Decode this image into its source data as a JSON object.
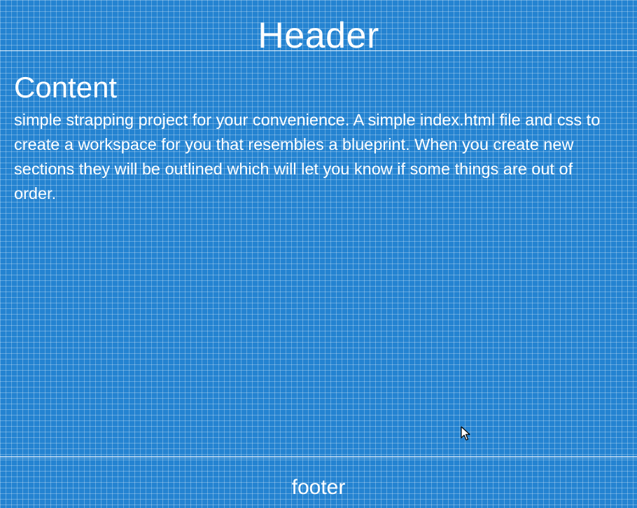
{
  "header": {
    "title": "Header"
  },
  "content": {
    "heading": "Content",
    "body": "simple strapping project for your convenience. A simple index.html file and css to create a workspace for you that resembles a blueprint. When you create new sections they will be outlined which will let you know if some things are out of order."
  },
  "footer": {
    "text": "footer"
  },
  "colors": {
    "background": "#2483d1",
    "grid_line": "#ffffff",
    "text": "#ffffff"
  },
  "icons": {
    "cursor": "mouse-pointer-icon"
  }
}
